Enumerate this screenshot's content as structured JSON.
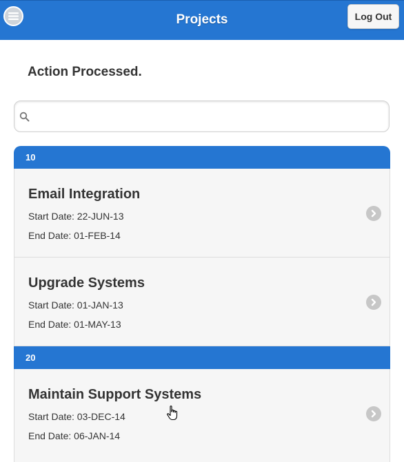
{
  "header": {
    "title": "Projects",
    "logout_label": "Log Out"
  },
  "status_message": "Action Processed.",
  "search": {
    "value": "",
    "placeholder": ""
  },
  "colors": {
    "header_bg": "#2576d2",
    "divider_bg": "#2576d2",
    "item_bg": "#f6f6f6",
    "text": "#333333"
  },
  "groups": [
    {
      "label": "10",
      "items": [
        {
          "name": "Email Integration",
          "start": "Start Date: 22-JUN-13",
          "end": "End Date: 01-FEB-14"
        },
        {
          "name": "Upgrade Systems",
          "start": "Start Date: 01-JAN-13",
          "end": "End Date: 01-MAY-13"
        }
      ]
    },
    {
      "label": "20",
      "items": [
        {
          "name": "Maintain Support Systems",
          "start": "Start Date: 03-DEC-14",
          "end": "End Date: 06-JAN-14"
        }
      ]
    }
  ]
}
